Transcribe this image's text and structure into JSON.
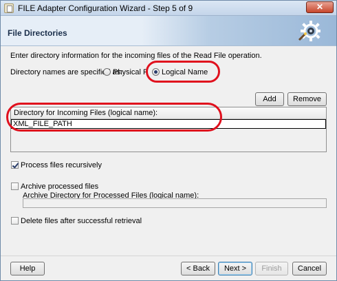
{
  "window": {
    "title": "FILE Adapter Configuration Wizard - Step 5 of 9",
    "close_label": "✕"
  },
  "header": {
    "title": "File Directories",
    "icon": "gear-wizard-icon"
  },
  "main": {
    "instruction": "Enter directory information for the incoming files of the Read File operation.",
    "directory_names_label": "Directory names are specified as:",
    "radio_physical": "Physical Path",
    "radio_logical": "Logical Name",
    "selected_option": "Logical Name",
    "add_label": "Add",
    "remove_label": "Remove",
    "table": {
      "header": "Directory for Incoming Files (logical name):",
      "rows": [
        "XML_FILE_PATH"
      ]
    },
    "process_recursively": {
      "label": "Process files recursively",
      "checked": true
    },
    "archive_processed": {
      "label": "Archive processed files",
      "checked": false
    },
    "archive_directory_label": "Archive Directory for Processed Files (logical name):",
    "archive_directory_value": "",
    "delete_after": {
      "label": "Delete files after successful retrieval",
      "checked": false
    }
  },
  "footer": {
    "help": "Help",
    "back": "< Back",
    "next": "Next >",
    "finish": "Finish",
    "cancel": "Cancel"
  },
  "colors": {
    "annotation": "#e0101d",
    "header_gradient_end": "#9ab8d8"
  }
}
